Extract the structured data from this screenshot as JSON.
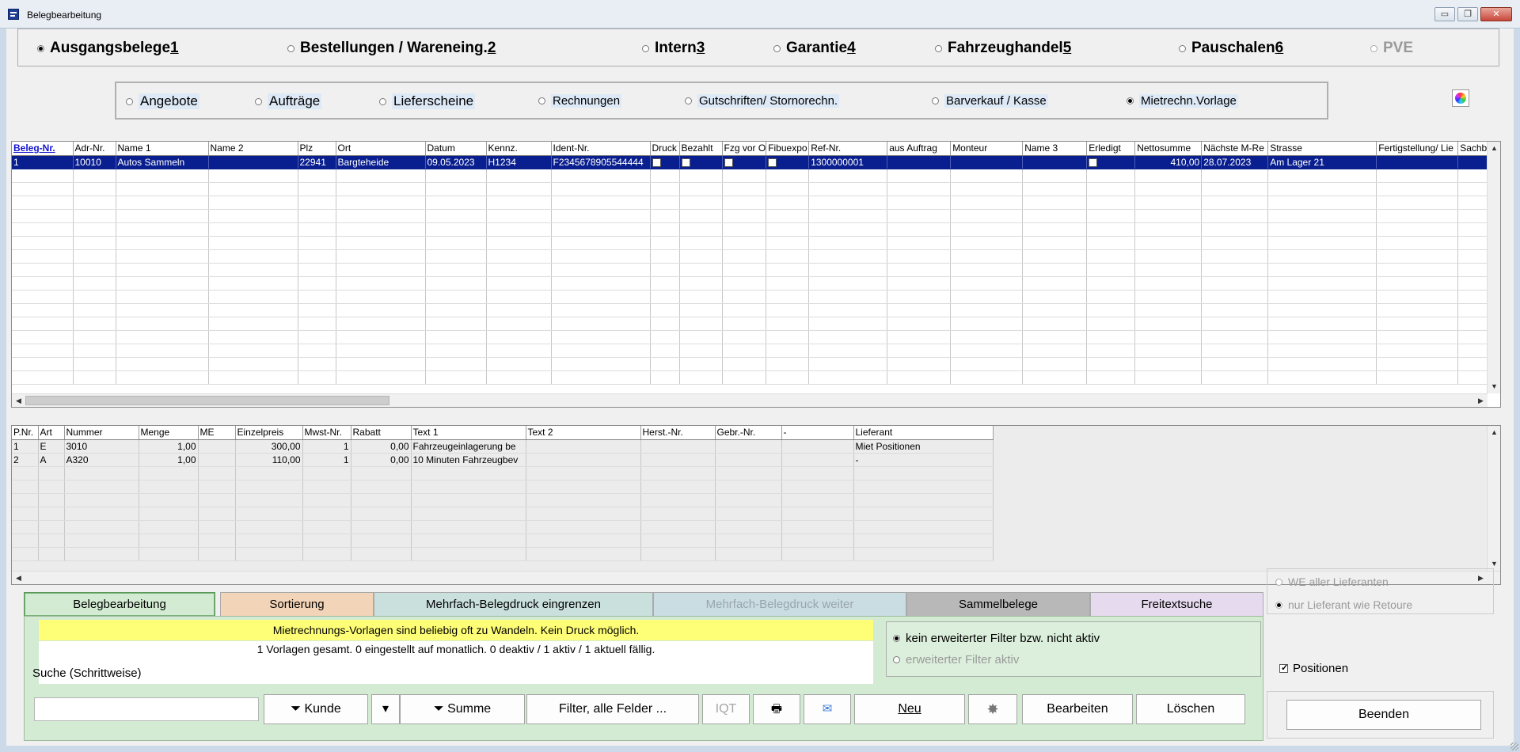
{
  "window": {
    "title": "Belegbearbeitung",
    "buttons": {
      "minimize": "▭",
      "maximize": "❐",
      "close": "✕"
    }
  },
  "main_radios": [
    {
      "label": "Ausgangsbelege ",
      "key": "1",
      "selected": true,
      "enabled": true
    },
    {
      "label": "Bestellungen / Wareneing. ",
      "key": "2",
      "selected": false,
      "enabled": true
    },
    {
      "label": "Intern ",
      "key": "3",
      "selected": false,
      "enabled": true
    },
    {
      "label": "Garantie ",
      "key": "4",
      "selected": false,
      "enabled": true
    },
    {
      "label": "Fahrzeughandel ",
      "key": "5",
      "selected": false,
      "enabled": true
    },
    {
      "label": "Pauschalen ",
      "key": "6",
      "selected": false,
      "enabled": true
    },
    {
      "label": "PVE",
      "key": "",
      "selected": false,
      "enabled": false
    }
  ],
  "doc_radios": [
    {
      "label": "Angebote",
      "selected": false
    },
    {
      "label": "Aufträge",
      "selected": false
    },
    {
      "label": "Lieferscheine",
      "selected": false
    },
    {
      "label": "Rechnungen",
      "selected": false
    },
    {
      "label": "Gutschriften/ Stornorechn.",
      "selected": false
    },
    {
      "label": "Barverkauf / Kasse",
      "selected": false
    },
    {
      "label": "Mietrechn.Vorlage",
      "selected": true
    }
  ],
  "doc_grid": {
    "columns": [
      "Beleg-Nr.",
      "Adr-Nr.",
      "Name 1",
      "Name 2",
      "Plz",
      "Ort",
      "Datum",
      "Kennz.",
      "Ident-Nr.",
      "Druck",
      "Bezahlt",
      "Fzg vor O",
      "Fibuexpo",
      "Ref-Nr.",
      "aus Auftrag",
      "Monteur",
      "Name 3",
      "Erledigt",
      "Nettosumme",
      "Nächste M-Re",
      "Strasse",
      "Fertigstellung/ Lie",
      "Sachb"
    ],
    "rows": [
      [
        "1",
        "10010",
        "Autos Sammeln",
        "",
        "22941",
        "Bargteheide",
        "09.05.2023",
        "H1234",
        "F2345678905544444",
        "",
        "",
        "",
        "",
        "1300000001",
        "",
        "",
        "",
        "",
        "410,00",
        "28.07.2023",
        "Am Lager 21",
        "",
        ""
      ]
    ]
  },
  "pos_grid": {
    "columns": [
      "P.Nr.",
      "Art",
      "Nummer",
      "Menge",
      "ME",
      "Einzelpreis",
      "Mwst-Nr.",
      "Rabatt",
      "Text 1",
      "Text 2",
      "Herst.-Nr.",
      "Gebr.-Nr.",
      "-",
      "Lieferant"
    ],
    "rows": [
      [
        "1",
        "E",
        "3010",
        "1,00",
        "",
        "300,00",
        "1",
        "0,00",
        "Fahrzeugeinlagerung be",
        "",
        "",
        "",
        "",
        "Miet Positionen"
      ],
      [
        "2",
        "A",
        "A320",
        "1,00",
        "",
        "110,00",
        "1",
        "0,00",
        "10 Minuten Fahrzeugbev",
        "",
        "",
        "",
        "",
        "-"
      ]
    ]
  },
  "tabs": [
    {
      "label": "Belegbearbeitung",
      "color": "#d3ebd3",
      "active": true,
      "enabled": true
    },
    {
      "label": "Sortierung",
      "color": "#f2d4b8",
      "active": false,
      "enabled": true
    },
    {
      "label": "Mehrfach-Belegdruck eingrenzen",
      "color": "#c9e0dd",
      "active": false,
      "enabled": true
    },
    {
      "label": "Mehrfach-Belegdruck weiter",
      "color": "#c9dde3",
      "active": false,
      "enabled": false
    },
    {
      "label": "Sammelbelege",
      "color": "#b8b8b8",
      "active": false,
      "enabled": true
    },
    {
      "label": "Freitextsuche",
      "color": "#e6daee",
      "active": false,
      "enabled": true
    }
  ],
  "info": {
    "warning": "Mietrechnungs-Vorlagen sind beliebig oft zu Wandeln. Kein Druck möglich.",
    "status": "1 Vorlagen gesamt. 0 eingestellt auf monatlich. 0 deaktiv / 1 aktiv / 1 aktuell fällig.",
    "search_label": "Suche (Schrittweise)"
  },
  "search": {
    "value": ""
  },
  "filter": {
    "option1": {
      "label": "kein erweiterter Filter bzw. nicht aktiv",
      "selected": true
    },
    "option2": {
      "label": "erweiterter Filter aktiv",
      "selected": false
    }
  },
  "buttons": {
    "kunde": "Kunde",
    "dropdown": "▾",
    "summe": "Summe",
    "filter_all": "Filter, alle Felder ...",
    "iqt": "IQT",
    "neu": "Neu",
    "bearbeiten": "Bearbeiten",
    "loeschen": "Löschen",
    "beenden": "Beenden"
  },
  "right_panel": {
    "we_all": "WE aller Lieferanten",
    "only_supplier": "nur Lieferant wie Retoure",
    "positionen": "Positionen",
    "positionen_checked": true
  }
}
